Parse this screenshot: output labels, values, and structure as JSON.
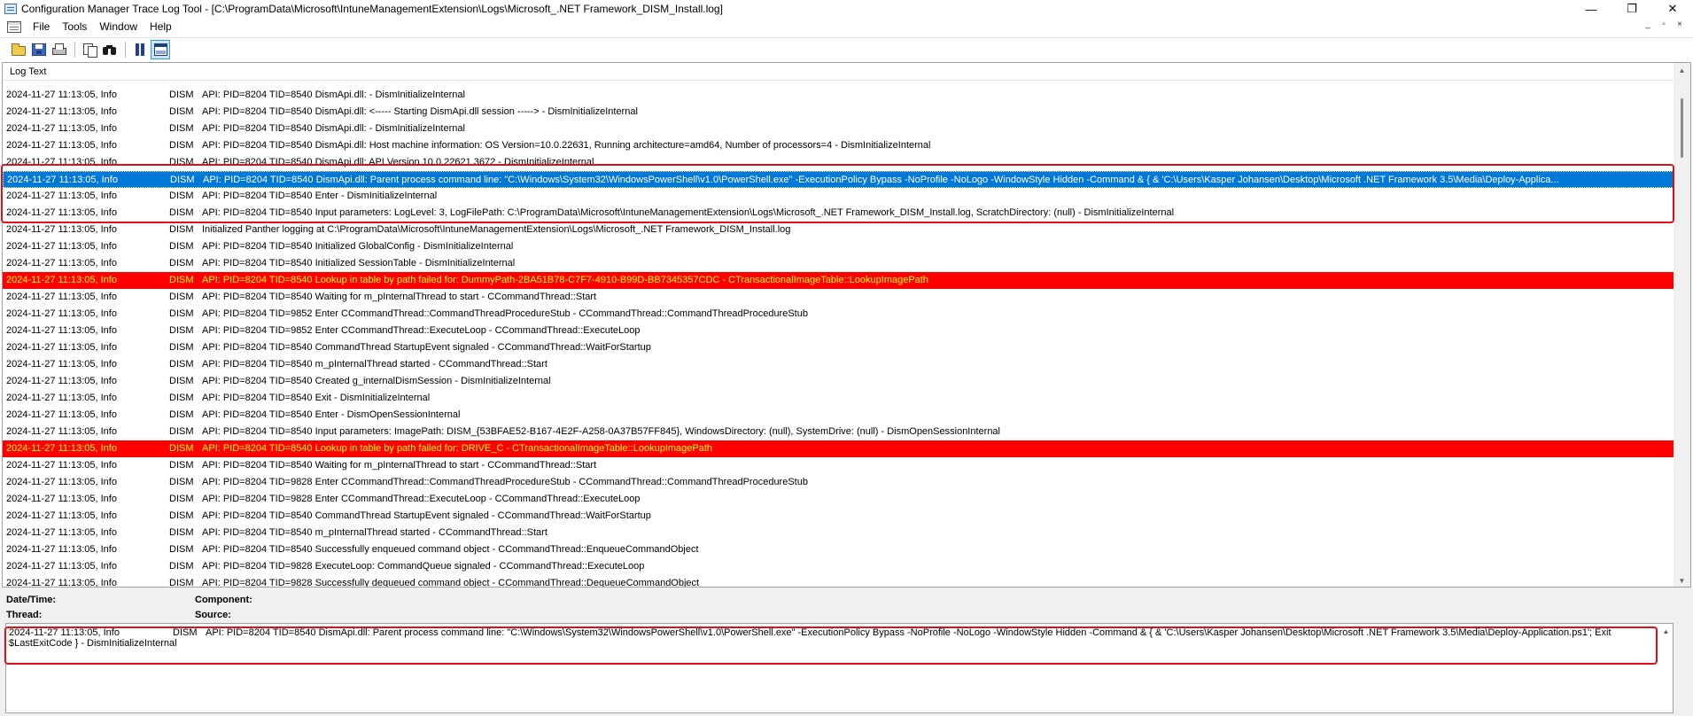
{
  "window": {
    "title": "Configuration Manager Trace Log Tool - [C:\\ProgramData\\Microsoft\\IntuneManagementExtension\\Logs\\Microsoft_.NET Framework_DISM_Install.log]",
    "minimize_glyph": "—",
    "restore_glyph": "❐",
    "close_glyph": "✕"
  },
  "menu": {
    "items": [
      "File",
      "Tools",
      "Window",
      "Help"
    ],
    "mdi_min": "_",
    "mdi_restore": "▫",
    "mdi_close": "×"
  },
  "toolbar": {
    "buttons": [
      "open-icon",
      "save-icon",
      "print-icon",
      "copy-icon",
      "find-icon",
      "pause-icon",
      "preview-pane-icon"
    ]
  },
  "log": {
    "header": "Log Text",
    "rows": [
      {
        "dt": "2024-11-27 11:13:05, Info",
        "comp": "DISM",
        "msg": "API: PID=8204 TID=8540 DismApi.dll:                                          - DismInitializeInternal",
        "state": "normal"
      },
      {
        "dt": "2024-11-27 11:13:05, Info",
        "comp": "DISM",
        "msg": "API: PID=8204 TID=8540 DismApi.dll: <----- Starting DismApi.dll session -----> - DismInitializeInternal",
        "state": "normal"
      },
      {
        "dt": "2024-11-27 11:13:05, Info",
        "comp": "DISM",
        "msg": "API: PID=8204 TID=8540 DismApi.dll:                                          - DismInitializeInternal",
        "state": "normal"
      },
      {
        "dt": "2024-11-27 11:13:05, Info",
        "comp": "DISM",
        "msg": "API: PID=8204 TID=8540 DismApi.dll: Host machine information: OS Version=10.0.22631, Running architecture=amd64, Number of processors=4 - DismInitializeInternal",
        "state": "normal"
      },
      {
        "dt": "2024-11-27 11:13:05, Info",
        "comp": "DISM",
        "msg": "API: PID=8204 TID=8540 DismApi.dll: API Version 10.0.22621.3672 - DismInitializeInternal",
        "state": "normal"
      },
      {
        "dt": "2024-11-27 11:13:05, Info",
        "comp": "DISM",
        "msg": "API: PID=8204 TID=8540 DismApi.dll: Parent process command line: \"C:\\Windows\\System32\\WindowsPowerShell\\v1.0\\PowerShell.exe\" -ExecutionPolicy Bypass -NoProfile -NoLogo -WindowStyle Hidden -Command & { & 'C:\\Users\\Kasper Johansen\\Desktop\\Microsoft .NET Framework 3.5\\Media\\Deploy-Applica...",
        "state": "selected"
      },
      {
        "dt": "2024-11-27 11:13:05, Info",
        "comp": "DISM",
        "msg": "API: PID=8204 TID=8540 Enter - DismInitializeInternal",
        "state": "normal"
      },
      {
        "dt": "2024-11-27 11:13:05, Info",
        "comp": "DISM",
        "msg": "API: PID=8204 TID=8540 Input parameters: LogLevel: 3, LogFilePath: C:\\ProgramData\\Microsoft\\IntuneManagementExtension\\Logs\\Microsoft_.NET Framework_DISM_Install.log, ScratchDirectory: (null) - DismInitializeInternal",
        "state": "normal"
      },
      {
        "dt": "2024-11-27 11:13:05, Info",
        "comp": "DISM",
        "msg": "Initialized Panther logging at C:\\ProgramData\\Microsoft\\IntuneManagementExtension\\Logs\\Microsoft_.NET Framework_DISM_Install.log",
        "state": "normal"
      },
      {
        "dt": "2024-11-27 11:13:05, Info",
        "comp": "DISM",
        "msg": "API: PID=8204 TID=8540 Initialized GlobalConfig - DismInitializeInternal",
        "state": "normal"
      },
      {
        "dt": "2024-11-27 11:13:05, Info",
        "comp": "DISM",
        "msg": "API: PID=8204 TID=8540 Initialized SessionTable - DismInitializeInternal",
        "state": "normal"
      },
      {
        "dt": "2024-11-27 11:13:05, Info",
        "comp": "DISM",
        "msg": "API: PID=8204 TID=8540 Lookup in table by path failed for: DummyPath-2BA51B78-C7F7-4910-B99D-BB7345357CDC - CTransactionalImageTable::LookupImagePath",
        "state": "error"
      },
      {
        "dt": "2024-11-27 11:13:05, Info",
        "comp": "DISM",
        "msg": "API: PID=8204 TID=8540 Waiting for m_pInternalThread to start - CCommandThread::Start",
        "state": "normal"
      },
      {
        "dt": "2024-11-27 11:13:05, Info",
        "comp": "DISM",
        "msg": "API: PID=8204 TID=9852 Enter CCommandThread::CommandThreadProcedureStub - CCommandThread::CommandThreadProcedureStub",
        "state": "normal"
      },
      {
        "dt": "2024-11-27 11:13:05, Info",
        "comp": "DISM",
        "msg": "API: PID=8204 TID=9852 Enter CCommandThread::ExecuteLoop - CCommandThread::ExecuteLoop",
        "state": "normal"
      },
      {
        "dt": "2024-11-27 11:13:05, Info",
        "comp": "DISM",
        "msg": "API: PID=8204 TID=8540 CommandThread StartupEvent signaled - CCommandThread::WaitForStartup",
        "state": "normal"
      },
      {
        "dt": "2024-11-27 11:13:05, Info",
        "comp": "DISM",
        "msg": "API: PID=8204 TID=8540 m_pInternalThread started - CCommandThread::Start",
        "state": "normal"
      },
      {
        "dt": "2024-11-27 11:13:05, Info",
        "comp": "DISM",
        "msg": "API: PID=8204 TID=8540 Created g_internalDismSession - DismInitializeInternal",
        "state": "normal"
      },
      {
        "dt": "2024-11-27 11:13:05, Info",
        "comp": "DISM",
        "msg": "API: PID=8204 TID=8540 Exit - DismInitializeInternal",
        "state": "normal"
      },
      {
        "dt": "2024-11-27 11:13:05, Info",
        "comp": "DISM",
        "msg": "API: PID=8204 TID=8540 Enter - DismOpenSessionInternal",
        "state": "normal"
      },
      {
        "dt": "2024-11-27 11:13:05, Info",
        "comp": "DISM",
        "msg": "API: PID=8204 TID=8540 Input parameters: ImagePath: DISM_{53BFAE52-B167-4E2F-A258-0A37B57FF845}, WindowsDirectory: (null), SystemDrive: (null) - DismOpenSessionInternal",
        "state": "normal"
      },
      {
        "dt": "2024-11-27 11:13:05, Info",
        "comp": "DISM",
        "msg": "API: PID=8204 TID=8540 Lookup in table by path failed for: DRIVE_C - CTransactionalImageTable::LookupImagePath",
        "state": "error"
      },
      {
        "dt": "2024-11-27 11:13:05, Info",
        "comp": "DISM",
        "msg": "API: PID=8204 TID=8540 Waiting for m_pInternalThread to start - CCommandThread::Start",
        "state": "normal"
      },
      {
        "dt": "2024-11-27 11:13:05, Info",
        "comp": "DISM",
        "msg": "API: PID=8204 TID=9828 Enter CCommandThread::CommandThreadProcedureStub - CCommandThread::CommandThreadProcedureStub",
        "state": "normal"
      },
      {
        "dt": "2024-11-27 11:13:05, Info",
        "comp": "DISM",
        "msg": "API: PID=8204 TID=9828 Enter CCommandThread::ExecuteLoop - CCommandThread::ExecuteLoop",
        "state": "normal"
      },
      {
        "dt": "2024-11-27 11:13:05, Info",
        "comp": "DISM",
        "msg": "API: PID=8204 TID=8540 CommandThread StartupEvent signaled - CCommandThread::WaitForStartup",
        "state": "normal"
      },
      {
        "dt": "2024-11-27 11:13:05, Info",
        "comp": "DISM",
        "msg": "API: PID=8204 TID=8540 m_pInternalThread started - CCommandThread::Start",
        "state": "normal"
      },
      {
        "dt": "2024-11-27 11:13:05, Info",
        "comp": "DISM",
        "msg": "API: PID=8204 TID=8540 Successfully enqueued command object - CCommandThread::EnqueueCommandObject",
        "state": "normal"
      },
      {
        "dt": "2024-11-27 11:13:05, Info",
        "comp": "DISM",
        "msg": "API: PID=8204 TID=9828 ExecuteLoop: CommandQueue signaled - CCommandThread::ExecuteLoop",
        "state": "normal"
      },
      {
        "dt": "2024-11-27 11:13:05, Info",
        "comp": "DISM",
        "msg": "API: PID=8204 TID=9828 Successfully dequeued command object - CCommandThread::DequeueCommandObject",
        "state": "normal"
      }
    ]
  },
  "details": {
    "datetime_label": "Date/Time:",
    "component_label": "Component:",
    "thread_label": "Thread:",
    "source_label": "Source:",
    "message_dt": "2024-11-27 11:13:05, Info",
    "message_comp": "DISM",
    "message_body": "API: PID=8204 TID=8540 DismApi.dll: Parent process command line: \"C:\\Windows\\System32\\WindowsPowerShell\\v1.0\\PowerShell.exe\" -ExecutionPolicy Bypass -NoProfile -NoLogo -WindowStyle Hidden -Command & { & 'C:\\Users\\Kasper Johansen\\Desktop\\Microsoft .NET Framework 3.5\\Media\\Deploy-Application.ps1'; Exit $LastExitCode } - DismInitializeInternal"
  },
  "colors": {
    "selected_row": "#0078d7",
    "error_row": "#ff0000",
    "error_text": "#ffff00",
    "annotation": "#e0101b"
  }
}
